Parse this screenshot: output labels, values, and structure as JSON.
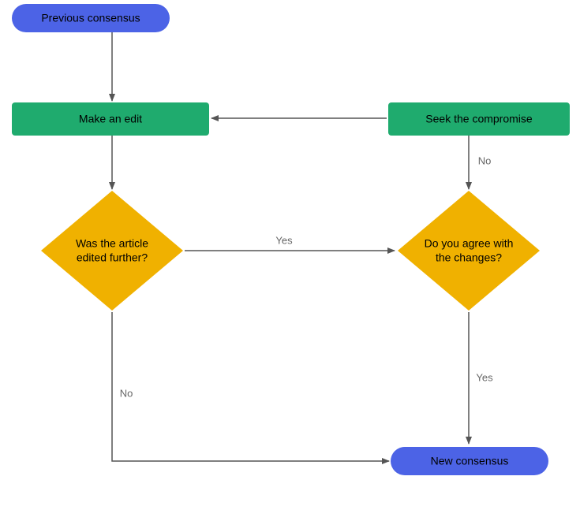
{
  "nodes": {
    "prev_consensus": "Previous consensus",
    "make_edit": "Make an edit",
    "seek_compromise": "Seek the compromise",
    "edited_further_l1": "Was the article",
    "edited_further_l2": "edited further?",
    "agree_l1": "Do you agree with",
    "agree_l2": "the changes?",
    "new_consensus": "New consensus"
  },
  "edges": {
    "edited_yes": "Yes",
    "edited_no": "No",
    "agree_yes": "Yes",
    "agree_no": "No"
  },
  "colors": {
    "blue": "#4c63e6",
    "green": "#1fab6e",
    "yellow": "#f0b100",
    "arrow": "#555"
  }
}
